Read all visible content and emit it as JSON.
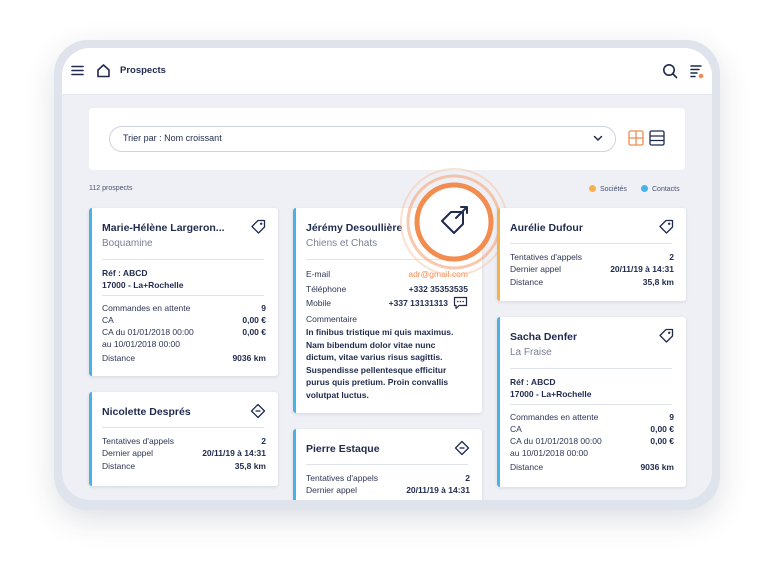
{
  "header": {
    "title": "Prospects"
  },
  "sort": {
    "label": "Trier par : Nom croissant"
  },
  "summary": {
    "count": "112 prospects",
    "legend_companies": "Sociétés",
    "legend_contacts": "Contacts"
  },
  "colors": {
    "contacts": "#4ab1e4",
    "companies": "#f5b04f",
    "accent": "#f28c4f",
    "text": "#1f2a4d"
  },
  "cards": {
    "c1": {
      "name": "Marie-Hélène Largeron...",
      "company": "Boquamine",
      "ref": "Réf : ABCD",
      "city": "17000 - La+Rochelle",
      "rows": [
        {
          "label": "Commandes en attente",
          "value": "9"
        },
        {
          "label": "CA",
          "value": "0,00 €"
        },
        {
          "label": "CA du 01/01/2018 00:00",
          "value": "0,00 €"
        },
        {
          "label": "au 10/01/2018 00:00",
          "value": ""
        },
        {
          "label": "Distance",
          "value": "9036 km"
        }
      ]
    },
    "c2": {
      "name": "Nicolette Després",
      "rows": [
        {
          "label": "Tentatives d'appels",
          "value": "2"
        },
        {
          "label": "Dernier appel",
          "value": "20/11/19 à 14:31"
        },
        {
          "label": "Distance",
          "value": "35,8 km"
        }
      ]
    },
    "c3": {
      "name": "Jérémy Desoullière",
      "company": "Chiens et Chats",
      "email_label": "E-mail",
      "email": "adr@gmail.com",
      "phone_label": "Téléphone",
      "phone": "+332 35353535",
      "mobile_label": "Mobile",
      "mobile": "+337 13131313",
      "comment_label": "Commentaire",
      "comment": "In finibus tristique mi quis maximus. Nam bibendum dolor vitae nunc dictum, vitae varius risus sagittis. Suspendisse pellentesque efficitur purus quis pretium. Proin convallis volutpat luctus."
    },
    "c4": {
      "name": "Pierre Estaque",
      "rows": [
        {
          "label": "Tentatives d'appels",
          "value": "2"
        },
        {
          "label": "Dernier appel",
          "value": "20/11/19 à 14:31"
        }
      ]
    },
    "c5": {
      "name": "Aurélie Dufour",
      "rows": [
        {
          "label": "Tentatives d'appels",
          "value": "2"
        },
        {
          "label": "Dernier appel",
          "value": "20/11/19 à 14:31"
        },
        {
          "label": "Distance",
          "value": "35,8 km"
        }
      ]
    },
    "c6": {
      "name": "Sacha Denfer",
      "company": "La Fraise",
      "ref": "Réf : ABCD",
      "city": "17000 - La+Rochelle",
      "rows": [
        {
          "label": "Commandes en attente",
          "value": "9"
        },
        {
          "label": "CA",
          "value": "0,00 €"
        },
        {
          "label": "CA du 01/01/2018 00:00",
          "value": "0,00 €"
        },
        {
          "label": "au 10/01/2018 00:00",
          "value": ""
        },
        {
          "label": "Distance",
          "value": "9036 km"
        }
      ]
    }
  }
}
